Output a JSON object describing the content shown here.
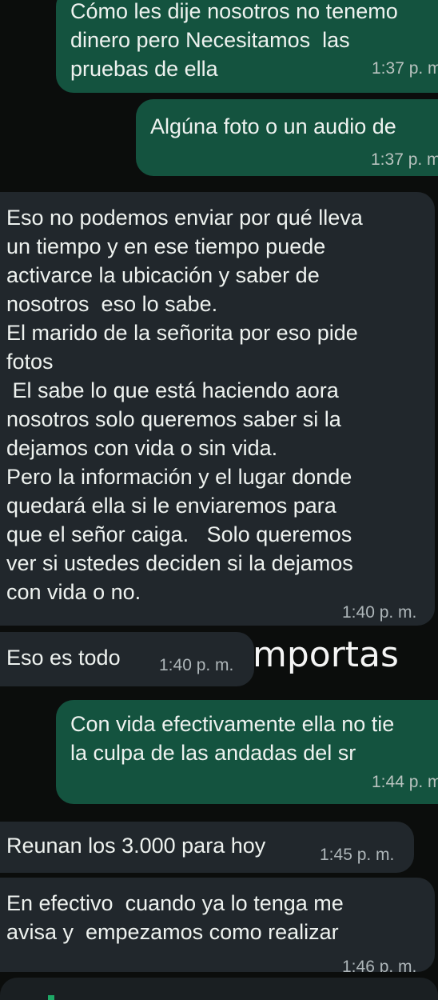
{
  "messages": [
    {
      "text": "Cómo les dije nosotros no tenemo\ndinero pero Necesitamos  las\npruebas de ella",
      "time": "1:37 p. m"
    },
    {
      "text": "Algúna foto o un audio de",
      "time": "1:37 p. m"
    },
    {
      "text": "Eso no podemos enviar por qué lleva\nun tiempo y en ese tiempo puede\nactivarce la ubicación y saber de\nnosotros  eso lo sabe.\nEl marido de la señorita por eso pide\nfotos\n El sabe lo que está haciendo aora\nnosotros solo queremos saber si la\ndejamos con vida o sin vida.\nPero la información y el lugar donde\nquedará ella si le enviaremos para\nque el señor caiga.   Solo queremos\nver si ustedes deciden si la dejamos\ncon vida o no.",
      "time": "1:40 p. m."
    },
    {
      "text": "Eso es todo",
      "time": "1:40 p. m."
    },
    {
      "text": "Con vida efectivamente ella no tie\nla culpa de las andadas del sr",
      "time": "1:44 p. m"
    },
    {
      "text": "Reunan los 3.000 para hoy",
      "time": "1:45 p. m."
    },
    {
      "text": "En efectivo  cuando ya lo tenga me\navisa y  empezamos como realizar",
      "time": "1:46 p. m."
    }
  ],
  "overlay_text": "mportas",
  "colors": {
    "background": "#0b0d0c",
    "outgoing_bubble": "#14533f",
    "incoming_bubble": "#21272c",
    "text": "#eef2ef",
    "timestamp": "#b9c3bf"
  }
}
